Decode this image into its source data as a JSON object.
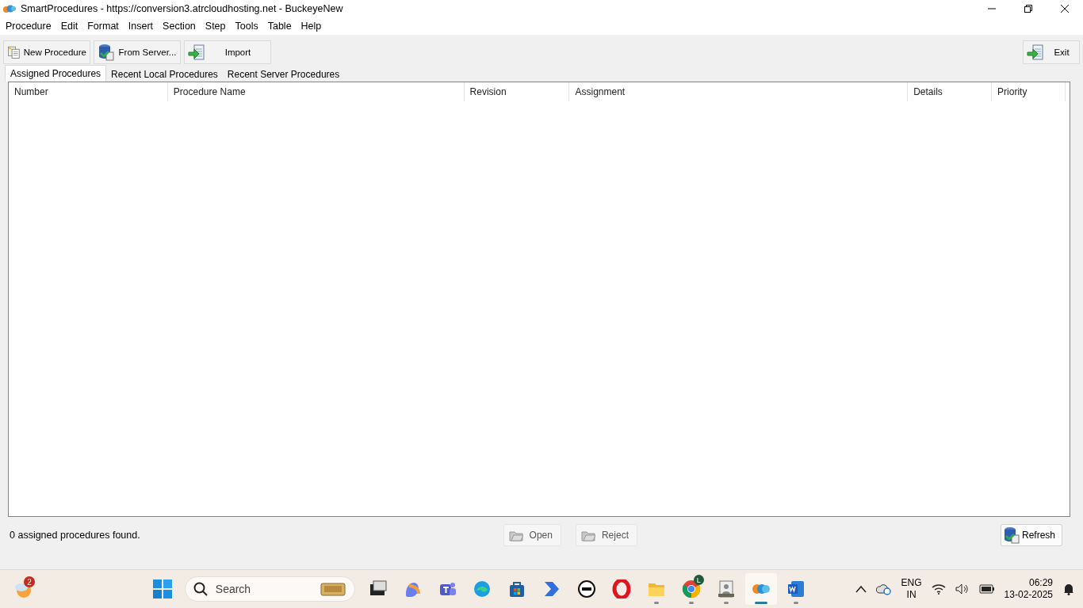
{
  "window": {
    "title": "SmartProcedures - https://conversion3.atrcloudhosting.net - BuckeyeNew"
  },
  "menu": [
    "Procedure",
    "Edit",
    "Format",
    "Insert",
    "Section",
    "Step",
    "Tools",
    "Table",
    "Help"
  ],
  "toolbar": [
    {
      "label": "New Procedure",
      "kind": "new"
    },
    {
      "label": "From Server...",
      "kind": "server"
    },
    {
      "label": "Import",
      "kind": "import"
    }
  ],
  "exit_button": {
    "label": "Exit",
    "kind": "import"
  },
  "tabs": [
    {
      "label": "Assigned Procedures",
      "selected": true
    },
    {
      "label": "Recent Local Procedures",
      "selected": false
    },
    {
      "label": "Recent Server Procedures",
      "selected": false
    }
  ],
  "table": {
    "columns": [
      "Number",
      "Procedure Name",
      "Revision",
      "Assignment",
      "Details",
      "Priority"
    ]
  },
  "status_text": "0 assigned procedures found.",
  "actions": [
    {
      "label": "Open",
      "disabled": true
    },
    {
      "label": "Reject",
      "disabled": true
    }
  ],
  "refresh_button": {
    "label": "Refresh"
  },
  "taskbar": {
    "widget_badge": "2",
    "search_placeholder": "Search",
    "apps": [
      {
        "kind": "taskview",
        "running": false,
        "selected": false
      },
      {
        "kind": "copilot",
        "running": false,
        "selected": false
      },
      {
        "kind": "teams",
        "running": false,
        "selected": false
      },
      {
        "kind": "edge",
        "running": false,
        "selected": false
      },
      {
        "kind": "store",
        "running": false,
        "selected": false
      },
      {
        "kind": "automate",
        "running": false,
        "selected": false
      },
      {
        "kind": "dell",
        "running": false,
        "selected": false
      },
      {
        "kind": "opera",
        "running": false,
        "selected": false
      },
      {
        "kind": "folder",
        "running": true,
        "selected": false
      },
      {
        "kind": "chrome",
        "running": true,
        "selected": false,
        "badge": "L"
      },
      {
        "kind": "contact",
        "running": true,
        "selected": false
      },
      {
        "kind": "smartproc",
        "running": true,
        "selected": true
      },
      {
        "kind": "word",
        "running": true,
        "selected": false
      }
    ],
    "language": "ENG",
    "region": "IN",
    "time": "06:29",
    "date": "13-02-2025"
  }
}
